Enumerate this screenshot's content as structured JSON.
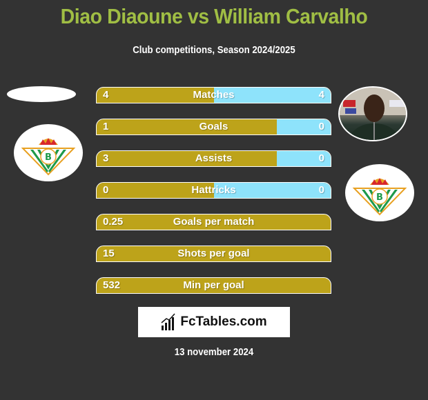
{
  "header": {
    "title": "Diao Diaoune vs William Carvalho",
    "subtitle": "Club competitions, Season 2024/2025"
  },
  "colors": {
    "left_player": "#bda31a",
    "right_player": "#8ee3fb",
    "title": "#a0be44",
    "background": "#333333"
  },
  "stats": [
    {
      "label": "Matches",
      "left": "4",
      "right": "4",
      "right_share": 0.5
    },
    {
      "label": "Goals",
      "left": "1",
      "right": "0",
      "right_share": 0.23
    },
    {
      "label": "Assists",
      "left": "3",
      "right": "0",
      "right_share": 0.23
    },
    {
      "label": "Hattricks",
      "left": "0",
      "right": "0",
      "right_share": 0.5
    },
    {
      "label": "Goals per match",
      "left": "0.25",
      "right": null,
      "right_share": 0
    },
    {
      "label": "Shots per goal",
      "left": "15",
      "right": null,
      "right_share": 0
    },
    {
      "label": "Min per goal",
      "left": "532",
      "right": null,
      "right_share": 0
    }
  ],
  "left_player": {
    "name": "Diao Diaoune",
    "club_badge": "real-betis-crest"
  },
  "right_player": {
    "name": "William Carvalho",
    "photo": "player-photo",
    "club_badge": "real-betis-crest"
  },
  "footer": {
    "brand": "FcTables.com",
    "date": "13 november 2024"
  }
}
